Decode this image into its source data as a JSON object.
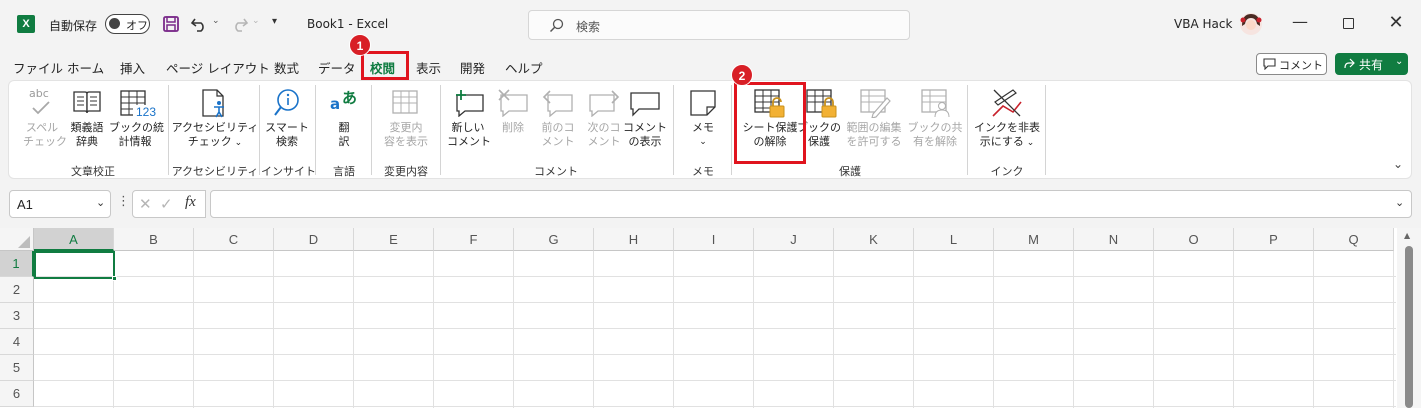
{
  "titlebar": {
    "autosave_label": "自動保存",
    "autosave_state": "オフ",
    "doc_title": "Book1  -  Excel",
    "search_placeholder": "検索",
    "user_name": "VBA Hack"
  },
  "tabs": [
    "ファイル",
    "ホーム",
    "挿入",
    "ページ レイアウト",
    "数式",
    "データ",
    "校閲",
    "表示",
    "開発",
    "ヘルプ"
  ],
  "active_tab": "校閲",
  "right_buttons": {
    "comment": "コメント",
    "share": "共有"
  },
  "ribbon": {
    "proofing": {
      "group": "文章校正",
      "spelling_l1": "スペル",
      "spelling_l2": "チェック",
      "thesaurus_l1": "類義語",
      "thesaurus_l2": "辞典",
      "stats_l1": "ブックの統",
      "stats_l2": "計情報",
      "spelling_icon_text": "abc",
      "stats_icon_text": "123"
    },
    "accessibility": {
      "group": "アクセシビリティ",
      "check_l1": "アクセシビリティ",
      "check_l2": "チェック"
    },
    "insights": {
      "group": "インサイト",
      "smart_l1": "スマート",
      "smart_l2": "検索"
    },
    "language": {
      "group": "言語",
      "translate_l1": "翻",
      "translate_l2": "訳",
      "translate_icon_a": "a",
      "translate_icon_b": "あ"
    },
    "changes": {
      "group": "変更内容",
      "show_l1": "変更内",
      "show_l2": "容を表示"
    },
    "comments": {
      "group": "コメント",
      "new_l1": "新しい",
      "new_l2": "コメント",
      "delete": "削除",
      "prev_l1": "前のコ",
      "prev_l2": "メント",
      "next_l1": "次のコ",
      "next_l2": "メント",
      "show_l1": "コメント",
      "show_l2": "の表示"
    },
    "notes": {
      "group": "メモ",
      "notes_label": "メモ"
    },
    "protect": {
      "group": "保護",
      "unprotect_l1": "シート保護",
      "unprotect_l2": "の解除",
      "protect_wb_l1": "ブックの",
      "protect_wb_l2": "保護",
      "allow_l1": "範囲の編集",
      "allow_l2": "を許可する",
      "unshare_l1": "ブックの共",
      "unshare_l2": "有を解除"
    },
    "ink": {
      "group": "インク",
      "hide_l1": "インクを非表",
      "hide_l2": "示にする"
    }
  },
  "formula_bar": {
    "name_box": "A1",
    "fx": "fx",
    "value": ""
  },
  "grid": {
    "columns": [
      "A",
      "B",
      "C",
      "D",
      "E",
      "F",
      "G",
      "H",
      "I",
      "J",
      "K",
      "L",
      "M",
      "N",
      "O",
      "P",
      "Q"
    ],
    "rows": [
      "1",
      "2",
      "3",
      "4",
      "5",
      "6"
    ],
    "selected_cell": "A1"
  },
  "annotations": [
    "1",
    "2"
  ],
  "colors": {
    "accent": "#107c41",
    "highlight": "#e0141e",
    "badge": "#d81f26"
  }
}
